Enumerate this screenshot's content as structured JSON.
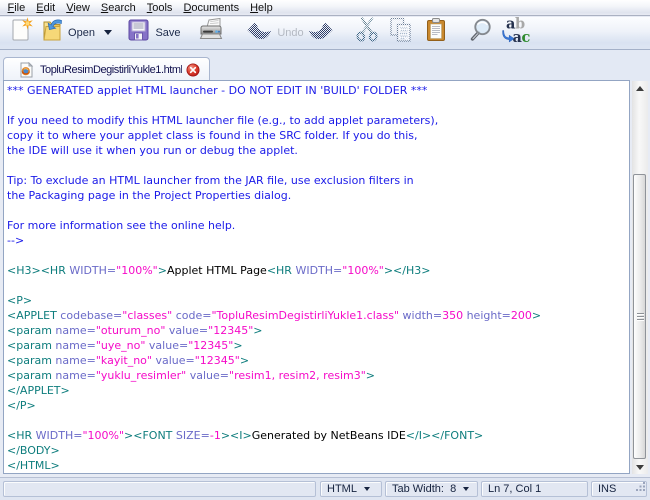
{
  "menu": {
    "items": [
      {
        "label": "File"
      },
      {
        "label": "Edit"
      },
      {
        "label": "View"
      },
      {
        "label": "Search"
      },
      {
        "label": "Tools"
      },
      {
        "label": "Documents"
      },
      {
        "label": "Help"
      }
    ]
  },
  "toolbar": {
    "buttons": [
      {
        "name": "new",
        "label": "",
        "disabled": false
      },
      {
        "name": "open",
        "label": "Open",
        "disabled": false,
        "has_dropdown": true
      },
      {
        "name": "save",
        "label": "Save",
        "disabled": false
      },
      {
        "name": "print",
        "label": "",
        "disabled": false
      },
      {
        "name": "undo",
        "label": "Undo",
        "disabled": true
      },
      {
        "name": "redo",
        "label": "",
        "disabled": true
      },
      {
        "name": "cut",
        "label": "",
        "disabled": true
      },
      {
        "name": "copy",
        "label": "",
        "disabled": true
      },
      {
        "name": "paste",
        "label": "",
        "disabled": false
      },
      {
        "name": "find",
        "label": "",
        "disabled": false
      },
      {
        "name": "replace",
        "label": "",
        "disabled": false
      }
    ]
  },
  "tab": {
    "filename": "TopluResimDegistirliYukle1.html",
    "icon": "html-file-icon",
    "close": "close"
  },
  "editor": {
    "lines": [
      {
        "t": [
          [
            "comment",
            "*** GENERATED applet HTML launcher - DO NOT EDIT IN 'BUILD' FOLDER ***"
          ]
        ]
      },
      {
        "t": []
      },
      {
        "t": [
          [
            "comment",
            "If you need to modify this HTML launcher file (e.g., to add applet parameters),"
          ]
        ]
      },
      {
        "t": [
          [
            "comment",
            "copy it to where your applet class is found in the SRC folder. If you do this,"
          ]
        ]
      },
      {
        "t": [
          [
            "comment",
            "the IDE will use it when you run or debug the applet."
          ]
        ]
      },
      {
        "t": []
      },
      {
        "t": [
          [
            "comment",
            "Tip: To exclude an HTML launcher from the JAR file, use exclusion filters in"
          ]
        ]
      },
      {
        "t": [
          [
            "comment",
            "the Packaging page in the Project Properties dialog."
          ]
        ]
      },
      {
        "t": []
      },
      {
        "t": [
          [
            "comment",
            "For more information see the online help."
          ]
        ]
      },
      {
        "t": [
          [
            "comment",
            "-->"
          ]
        ]
      },
      {
        "t": []
      },
      {
        "t": [
          [
            "tag",
            "<H3><HR "
          ],
          [
            "attr",
            "WIDTH="
          ],
          [
            "str",
            "\"100%\""
          ],
          [
            "tag",
            ">"
          ],
          [
            "text",
            "Applet HTML Page"
          ],
          [
            "tag",
            "<HR "
          ],
          [
            "attr",
            "WIDTH="
          ],
          [
            "str",
            "\"100%\""
          ],
          [
            "tag",
            "></H3>"
          ]
        ]
      },
      {
        "t": []
      },
      {
        "t": [
          [
            "tag",
            "<P>"
          ]
        ]
      },
      {
        "t": [
          [
            "tag",
            "<APPLET"
          ],
          [
            "attr",
            " codebase="
          ],
          [
            "str",
            "\"classes\""
          ],
          [
            "attr",
            " code="
          ],
          [
            "str",
            "\"TopluResimDegistirliYukle1.class\""
          ],
          [
            "attr",
            " width="
          ],
          [
            "str",
            "350"
          ],
          [
            "attr",
            " height="
          ],
          [
            "str",
            "200"
          ],
          [
            "tag",
            ">"
          ]
        ]
      },
      {
        "t": [
          [
            "tag",
            "<param"
          ],
          [
            "attr",
            " name="
          ],
          [
            "str",
            "\"oturum_no\""
          ],
          [
            "attr",
            " value="
          ],
          [
            "str",
            "\"12345\""
          ],
          [
            "tag",
            ">"
          ]
        ]
      },
      {
        "t": [
          [
            "tag",
            "<param"
          ],
          [
            "attr",
            " name="
          ],
          [
            "str",
            "\"uye_no\""
          ],
          [
            "attr",
            " value="
          ],
          [
            "str",
            "\"12345\""
          ],
          [
            "tag",
            ">"
          ]
        ]
      },
      {
        "t": [
          [
            "tag",
            "<param"
          ],
          [
            "attr",
            " name="
          ],
          [
            "str",
            "\"kayit_no\""
          ],
          [
            "attr",
            " value="
          ],
          [
            "str",
            "\"12345\""
          ],
          [
            "tag",
            ">"
          ]
        ]
      },
      {
        "t": [
          [
            "tag",
            "<param"
          ],
          [
            "attr",
            " name="
          ],
          [
            "str",
            "\"yuklu_resimler\""
          ],
          [
            "attr",
            " value="
          ],
          [
            "str",
            "\"resim1, resim2, resim3\""
          ],
          [
            "tag",
            ">"
          ]
        ]
      },
      {
        "t": [
          [
            "tag",
            "</APPLET>"
          ]
        ]
      },
      {
        "t": [
          [
            "tag",
            "</P>"
          ]
        ]
      },
      {
        "t": []
      },
      {
        "t": [
          [
            "tag",
            "<HR "
          ],
          [
            "attr",
            "WIDTH="
          ],
          [
            "str",
            "\"100%\""
          ],
          [
            "tag",
            "><FONT "
          ],
          [
            "attr",
            "SIZE="
          ],
          [
            "str",
            "-1"
          ],
          [
            "tag",
            "><I>"
          ],
          [
            "text",
            "Generated by NetBeans IDE"
          ],
          [
            "tag",
            "</I></FONT>"
          ]
        ]
      },
      {
        "t": [
          [
            "tag",
            "</BODY>"
          ]
        ]
      },
      {
        "t": [
          [
            "tag",
            "</HTML>"
          ]
        ]
      }
    ]
  },
  "statusbar": {
    "language": "HTML",
    "tab_width_label": "Tab Width:",
    "tab_width": "8",
    "cursor_position": "Ln 7, Col 1",
    "input_mode": "INS"
  },
  "colors": {
    "comment": "#1a1ae8",
    "tag": "#0e7d7d",
    "attr": "#6a6ac8",
    "string": "#f50ac8",
    "text": "#000000",
    "tab_label": "#12124e",
    "close_button_red": "#cc2020"
  }
}
